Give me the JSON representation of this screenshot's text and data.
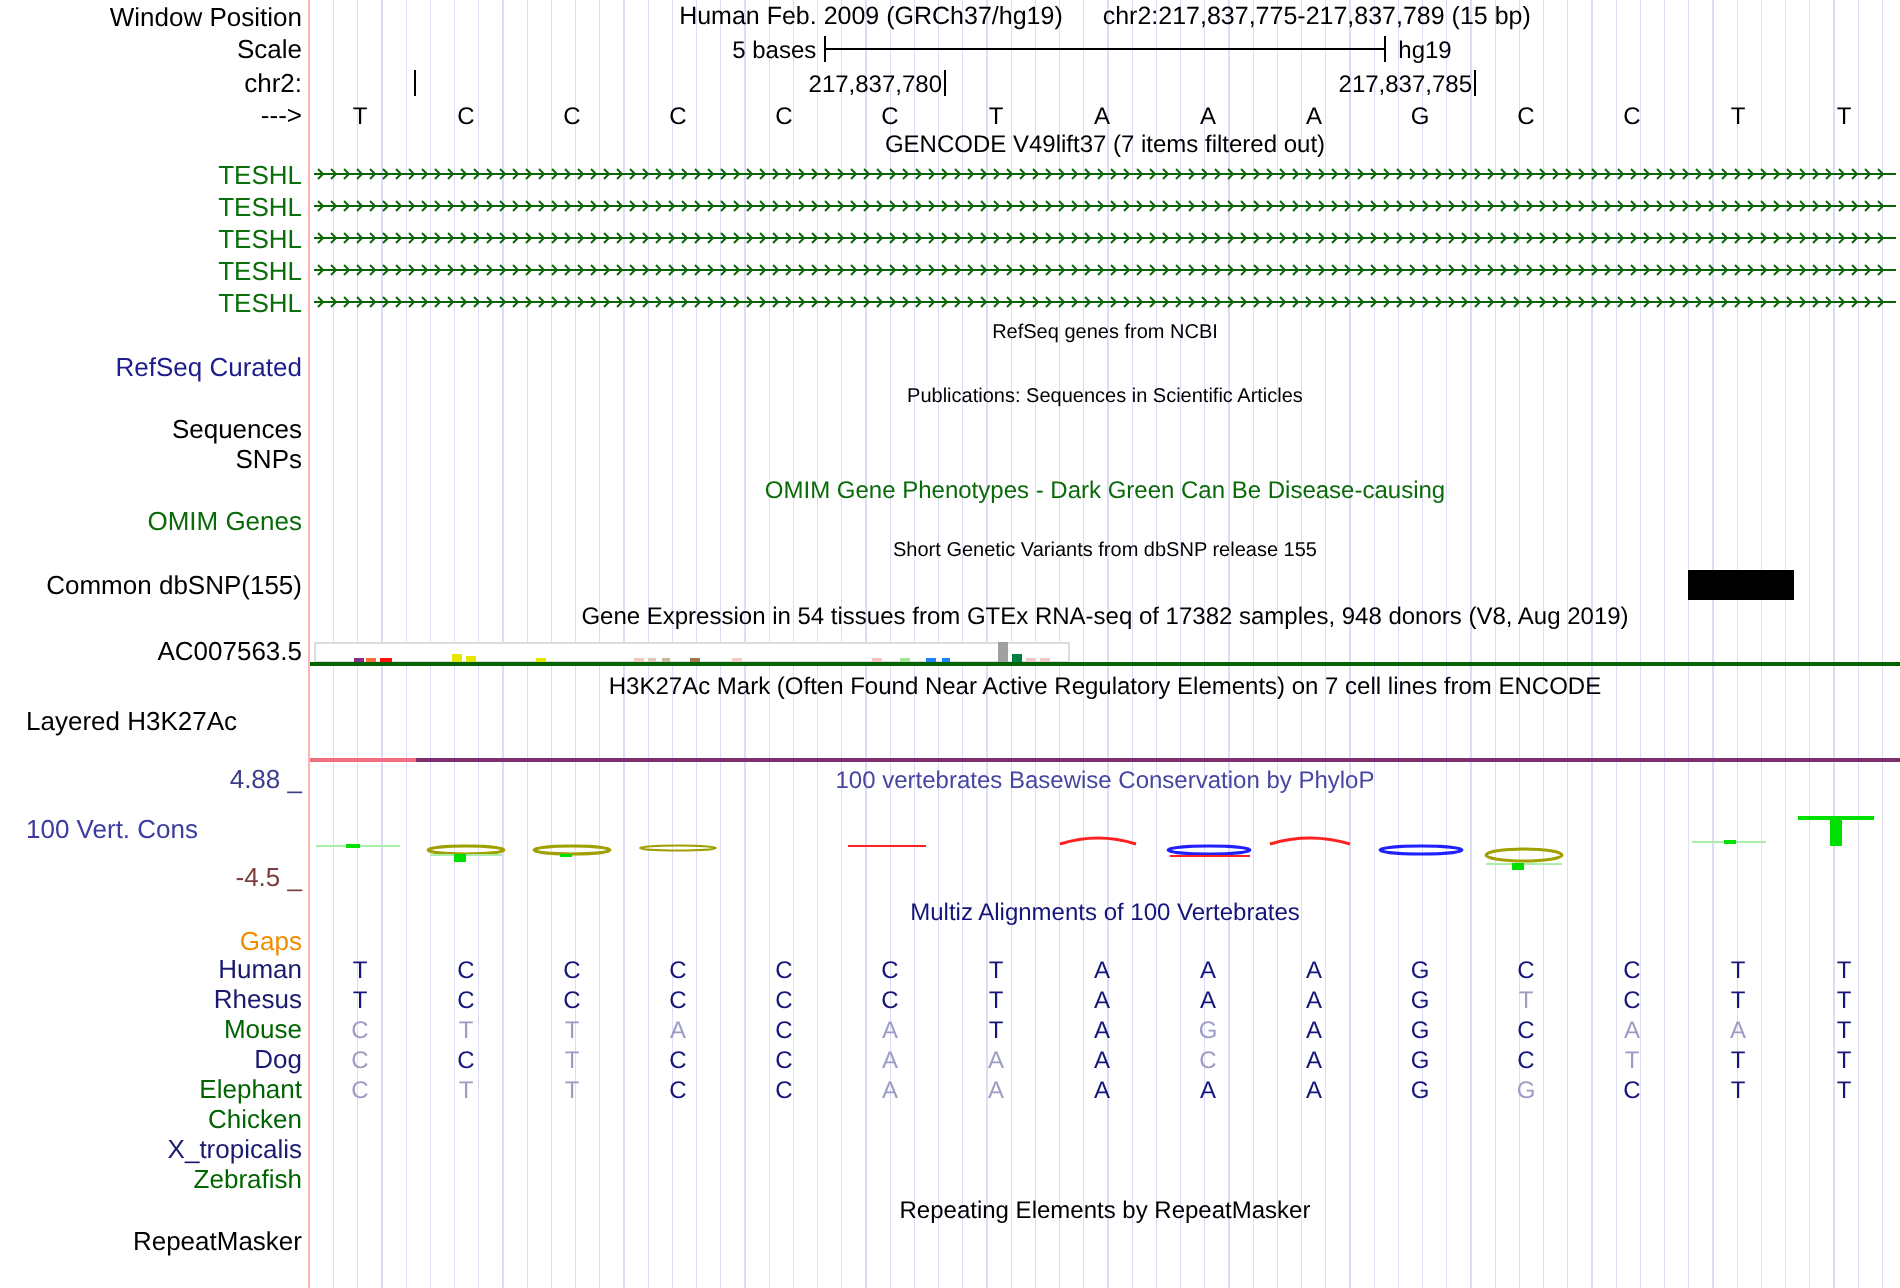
{
  "header": {
    "label": "Window Position",
    "assembly": "Human Feb. 2009 (GRCh37/hg19)",
    "position": "chr2:217,837,775-217,837,789 (15 bp)"
  },
  "scale": {
    "label": "Scale",
    "length": "5 bases",
    "assembly": "hg19"
  },
  "ruler": {
    "label": "chr2:",
    "ticks": [
      "217,837,780",
      "217,837,785"
    ]
  },
  "sequence": {
    "label": "--->",
    "bases": [
      "T",
      "C",
      "C",
      "C",
      "C",
      "C",
      "T",
      "A",
      "A",
      "A",
      "G",
      "C",
      "C",
      "T",
      "T"
    ]
  },
  "gencode": {
    "title": "GENCODE V49lift37 (7 items filtered out)",
    "genes": [
      "TESHL",
      "TESHL",
      "TESHL",
      "TESHL",
      "TESHL"
    ]
  },
  "refseq": {
    "title": "RefSeq genes from NCBI",
    "label": "RefSeq Curated"
  },
  "publications": {
    "title": "Publications: Sequences in Scientific Articles",
    "labels": [
      "Sequences",
      "SNPs"
    ]
  },
  "omim": {
    "title": "OMIM Gene Phenotypes - Dark Green Can Be Disease-causing",
    "label": "OMIM Genes"
  },
  "dbsnp": {
    "title": "Short Genetic Variants from dbSNP release 155",
    "label": "Common dbSNP(155)"
  },
  "gtex": {
    "title": "Gene Expression in 54 tissues from GTEx RNA-seq of 17382 samples, 948 donors (V8, Aug 2019)",
    "label": "AC007563.5"
  },
  "h3k27ac": {
    "title": "H3K27Ac Mark (Often Found Near Active Regulatory Elements) on 7 cell lines from ENCODE",
    "label": "Layered H3K27Ac"
  },
  "conservation": {
    "title": "100 vertebrates Basewise Conservation by PhyloP",
    "label": "100 Vert. Cons",
    "axis_max": "4.88 _",
    "axis_min": "-4.5 _"
  },
  "multiz": {
    "title": "Multiz Alignments of 100 Vertebrates",
    "gaps_label": "Gaps",
    "species": [
      {
        "name": "Human",
        "color": "#191970",
        "bases": [
          {
            "base": "T",
            "match": true
          },
          {
            "base": "C",
            "match": true
          },
          {
            "base": "C",
            "match": true
          },
          {
            "base": "C",
            "match": true
          },
          {
            "base": "C",
            "match": true
          },
          {
            "base": "C",
            "match": true
          },
          {
            "base": "T",
            "match": true
          },
          {
            "base": "A",
            "match": true
          },
          {
            "base": "A",
            "match": true
          },
          {
            "base": "A",
            "match": true
          },
          {
            "base": "G",
            "match": true
          },
          {
            "base": "C",
            "match": true
          },
          {
            "base": "C",
            "match": true
          },
          {
            "base": "T",
            "match": true
          },
          {
            "base": "T",
            "match": true
          }
        ]
      },
      {
        "name": "Rhesus",
        "color": "#191970",
        "bases": [
          {
            "base": "T",
            "match": true
          },
          {
            "base": "C",
            "match": true
          },
          {
            "base": "C",
            "match": true
          },
          {
            "base": "C",
            "match": true
          },
          {
            "base": "C",
            "match": true
          },
          {
            "base": "C",
            "match": true
          },
          {
            "base": "T",
            "match": true
          },
          {
            "base": "A",
            "match": true
          },
          {
            "base": "A",
            "match": true
          },
          {
            "base": "A",
            "match": true
          },
          {
            "base": "G",
            "match": true
          },
          {
            "base": "T",
            "match": false
          },
          {
            "base": "C",
            "match": true
          },
          {
            "base": "T",
            "match": true
          },
          {
            "base": "T",
            "match": true
          }
        ]
      },
      {
        "name": "Mouse",
        "color": "#006400",
        "bases": [
          {
            "base": "C",
            "match": false
          },
          {
            "base": "T",
            "match": false
          },
          {
            "base": "T",
            "match": false
          },
          {
            "base": "A",
            "match": false
          },
          {
            "base": "C",
            "match": true
          },
          {
            "base": "A",
            "match": false
          },
          {
            "base": "T",
            "match": true
          },
          {
            "base": "A",
            "match": true
          },
          {
            "base": "G",
            "match": false
          },
          {
            "base": "A",
            "match": true
          },
          {
            "base": "G",
            "match": true
          },
          {
            "base": "C",
            "match": true
          },
          {
            "base": "A",
            "match": false
          },
          {
            "base": "A",
            "match": false
          },
          {
            "base": "T",
            "match": true
          }
        ]
      },
      {
        "name": "Dog",
        "color": "#191970",
        "bases": [
          {
            "base": "C",
            "match": false
          },
          {
            "base": "C",
            "match": true
          },
          {
            "base": "T",
            "match": false
          },
          {
            "base": "C",
            "match": true
          },
          {
            "base": "C",
            "match": true
          },
          {
            "base": "A",
            "match": false
          },
          {
            "base": "A",
            "match": false
          },
          {
            "base": "A",
            "match": true
          },
          {
            "base": "C",
            "match": false
          },
          {
            "base": "A",
            "match": true
          },
          {
            "base": "G",
            "match": true
          },
          {
            "base": "C",
            "match": true
          },
          {
            "base": "T",
            "match": false
          },
          {
            "base": "T",
            "match": true
          },
          {
            "base": "T",
            "match": true
          }
        ]
      },
      {
        "name": "Elephant",
        "color": "#006400",
        "bases": [
          {
            "base": "C",
            "match": false
          },
          {
            "base": "T",
            "match": false
          },
          {
            "base": "T",
            "match": false
          },
          {
            "base": "C",
            "match": true
          },
          {
            "base": "C",
            "match": true
          },
          {
            "base": "A",
            "match": false
          },
          {
            "base": "A",
            "match": false
          },
          {
            "base": "A",
            "match": true
          },
          {
            "base": "A",
            "match": true
          },
          {
            "base": "A",
            "match": true
          },
          {
            "base": "G",
            "match": true
          },
          {
            "base": "G",
            "match": false
          },
          {
            "base": "C",
            "match": true
          },
          {
            "base": "T",
            "match": true
          },
          {
            "base": "T",
            "match": true
          }
        ]
      },
      {
        "name": "Chicken",
        "color": "#006400"
      },
      {
        "name": "X_tropicalis",
        "color": "#191970"
      },
      {
        "name": "Zebrafish",
        "color": "#006400"
      }
    ]
  },
  "repeatmasker": {
    "title": "Repeating Elements by RepeatMasker",
    "label": "RepeatMasker"
  }
}
